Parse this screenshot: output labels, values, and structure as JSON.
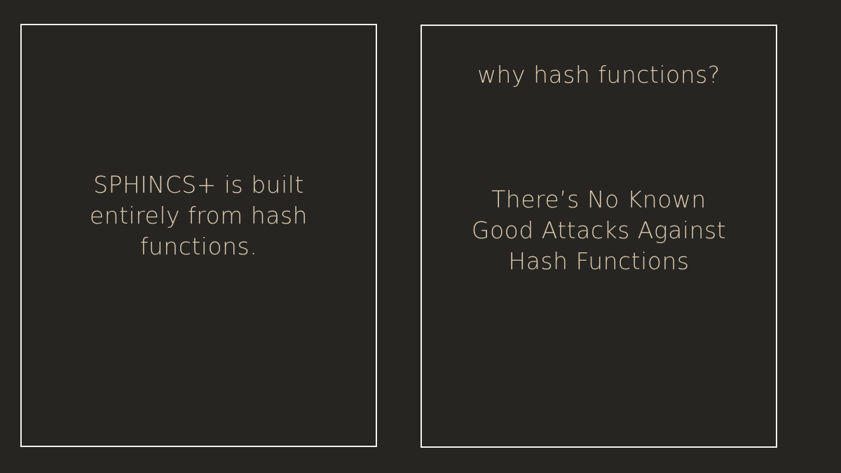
{
  "left_panel": {
    "statement": "SPHINCS+ is built entirely from hash functions."
  },
  "right_panel": {
    "heading": "why hash functions?",
    "statement": "There’s No Known Good Attacks Against Hash Functions"
  },
  "colors": {
    "background": "#262522",
    "border": "#f4f2ee",
    "text": "#dcc8ad"
  }
}
